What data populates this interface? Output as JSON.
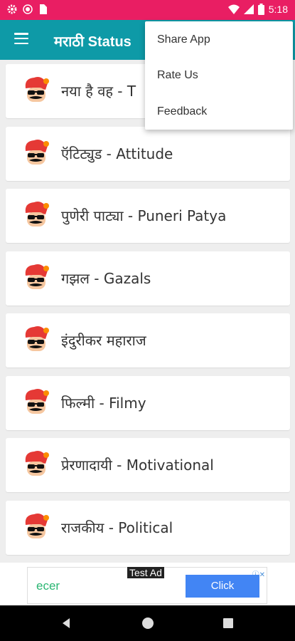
{
  "status_bar": {
    "time": "5:18",
    "icons": [
      "settings-icon",
      "circle-icon",
      "sim-icon",
      "wifi-icon",
      "signal-icon",
      "battery-icon"
    ]
  },
  "app_bar": {
    "title": "मराठी Status",
    "menu_icon": "hamburger-icon"
  },
  "categories": [
    {
      "label": "नया है वह - T"
    },
    {
      "label": "ऍटिट्युड - Attitude"
    },
    {
      "label": "पुणेरी पाट्या - Puneri Patya"
    },
    {
      "label": "गझल - Gazals"
    },
    {
      "label": "इंदुरीकर महाराज"
    },
    {
      "label": "फिल्मी - Filmy"
    },
    {
      "label": "प्रेरणादायी - Motivational"
    },
    {
      "label": "राजकीय - Political"
    }
  ],
  "overflow_menu": {
    "items": [
      {
        "label": "Share App"
      },
      {
        "label": "Rate Us"
      },
      {
        "label": "Feedback"
      }
    ]
  },
  "ad": {
    "tag": "Test Ad",
    "brand": "ecer",
    "button_label": "Click"
  },
  "colors": {
    "status_bar": "#e91e63",
    "app_bar": "#0e9aa7",
    "ad_button": "#4285f4",
    "ad_brand": "#2bb673"
  }
}
